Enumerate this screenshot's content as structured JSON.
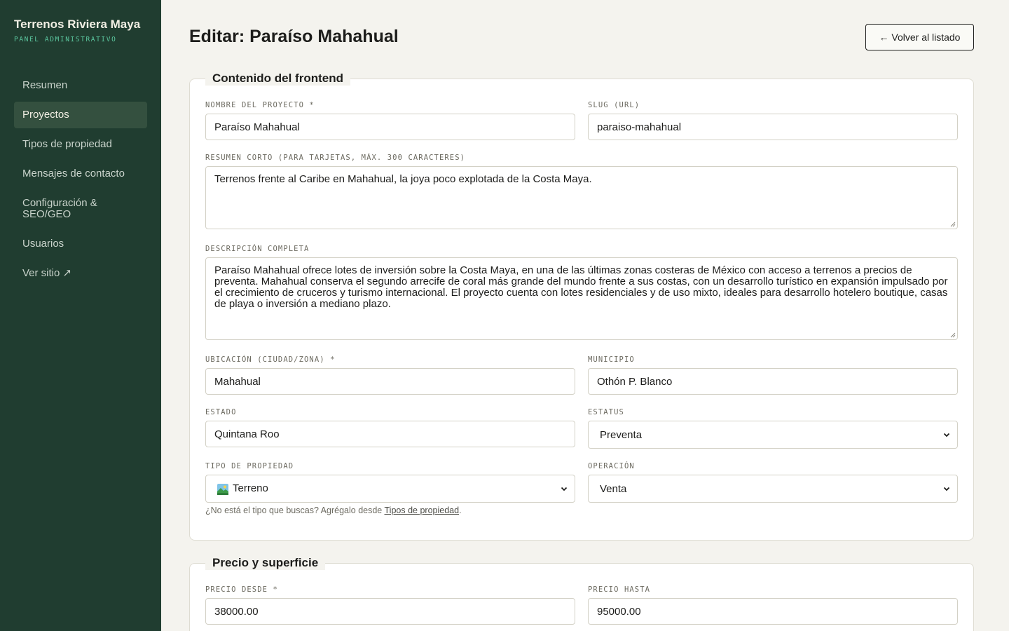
{
  "sidebar": {
    "brand_title": "Terrenos Riviera Maya",
    "brand_sub": "PANEL ADMINISTRATIVO",
    "items": [
      {
        "label": "Resumen"
      },
      {
        "label": "Proyectos"
      },
      {
        "label": "Tipos de propiedad"
      },
      {
        "label": "Mensajes de contacto"
      },
      {
        "label": "Configuración & SEO/GEO"
      },
      {
        "label": "Usuarios"
      },
      {
        "label": "Ver sitio ↗"
      }
    ],
    "active_item": "Proyectos"
  },
  "header": {
    "title": "Editar: Paraíso Mahahual",
    "back_label": "← Volver al listado"
  },
  "content_section": {
    "legend": "Contenido del frontend",
    "name_label": "NOMBRE DEL PROYECTO *",
    "name_value": "Paraíso Mahahual",
    "slug_label": "SLUG (URL)",
    "slug_value": "paraiso-mahahual",
    "summary_label": "RESUMEN CORTO (PARA TARJETAS, MÁX. 300 CARACTERES)",
    "summary_value": "Terrenos frente al Caribe en Mahahual, la joya poco explotada de la Costa Maya.",
    "description_label": "DESCRIPCIÓN COMPLETA",
    "description_value": "Paraíso Mahahual ofrece lotes de inversión sobre la Costa Maya, en una de las últimas zonas costeras de México con acceso a terrenos a precios de preventa. Mahahual conserva el segundo arrecife de coral más grande del mundo frente a sus costas, con un desarrollo turístico en expansión impulsado por el crecimiento de cruceros y turismo internacional. El proyecto cuenta con lotes residenciales y de uso mixto, ideales para desarrollo hotelero boutique, casas de playa o inversión a mediano plazo.",
    "location_label": "UBICACIÓN (CIUDAD/ZONA) *",
    "location_value": "Mahahual",
    "municipality_label": "MUNICIPIO",
    "municipality_value": "Othón P. Blanco",
    "state_label": "ESTADO",
    "state_value": "Quintana Roo",
    "status_label": "ESTATUS",
    "status_value": "Preventa",
    "property_type_label": "TIPO DE PROPIEDAD",
    "property_type_value": "Terreno",
    "property_type_icon": "landscape-icon",
    "operation_label": "OPERACIÓN",
    "operation_value": "Venta",
    "hint_text": "¿No está el tipo que buscas? Agrégalo desde ",
    "hint_link": "Tipos de propiedad",
    "hint_end": "."
  },
  "price_section": {
    "legend": "Precio y superficie",
    "price_from_label": "PRECIO DESDE *",
    "price_from_value": "38000.00",
    "price_to_label": "PRECIO HASTA",
    "price_to_value": "95000.00"
  },
  "colors": {
    "sidebar_bg": "#203d30",
    "accent": "#5cc8a0",
    "page_bg": "#f4f3ee"
  }
}
